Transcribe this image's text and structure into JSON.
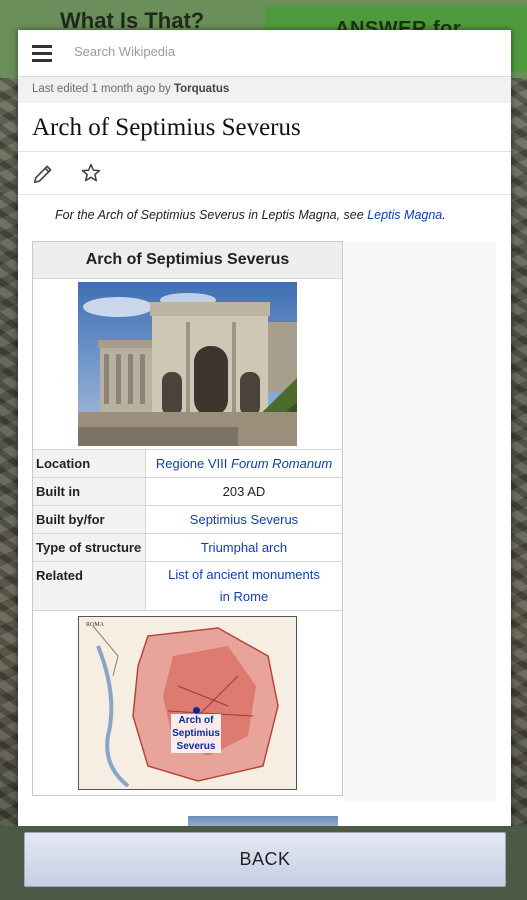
{
  "app": {
    "title": "What Is That?",
    "answer_label": "ANSWER for"
  },
  "wiki": {
    "search_placeholder": "Search Wikipedia",
    "last_edited_prefix": "Last edited 1 month ago by ",
    "last_edited_user": "Torquatus",
    "page_title": "Arch of Septimius Severus",
    "hatnote_text": "For the Arch of Septimius Severus in Leptis Magna, see ",
    "hatnote_link": "Leptis Magna",
    "hatnote_end": "."
  },
  "infobox": {
    "title": "Arch of Septimius Severus",
    "rows": [
      {
        "label": "Location",
        "value_link": "Regione VIII",
        "value_italic": "Forum Romanum"
      },
      {
        "label": "Built in",
        "value": "203 AD"
      },
      {
        "label": "Built by/for",
        "value_link": "Septimius Severus"
      },
      {
        "label": "Type of structure",
        "value_link": "Triumphal arch"
      },
      {
        "label": "Related",
        "value_link": "List of ancient monuments in Rome"
      }
    ],
    "map_label": "Arch of Septimius Severus"
  },
  "footer": {
    "back_label": "BACK"
  },
  "icons": {
    "menu": "hamburger-menu-icon",
    "edit": "pencil-icon",
    "watch": "star-icon"
  }
}
